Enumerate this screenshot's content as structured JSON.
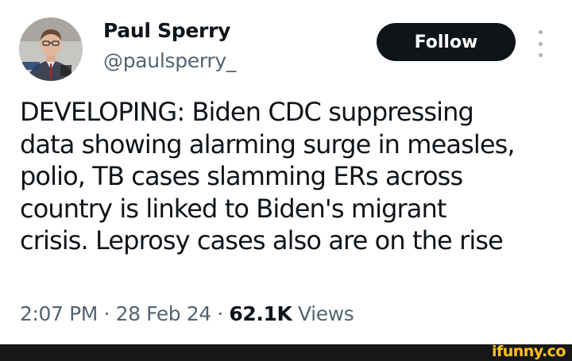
{
  "header": {
    "display_name": "Paul Sperry",
    "handle": "@paulsperry_",
    "follow_label": "Follow",
    "more_icon": "more-vertical-icon"
  },
  "tweet": {
    "text": "DEVELOPING: Biden CDC suppressing\ndata showing alarming surge in measles,\npolio, TB cases slamming ERs across\ncountry is linked to Biden's migrant\ncrisis. Leprosy cases also are on the rise"
  },
  "meta": {
    "time": "2:07 PM",
    "separator": "·",
    "date": "28 Feb 24",
    "views_count": "62.1K",
    "views_label": "Views"
  },
  "footer": {
    "watermark": "ifunny.co"
  },
  "colors": {
    "text_primary": "#0f1419",
    "text_secondary": "#536471",
    "follow_bg": "#0f1419",
    "watermark": "#ffc21d",
    "footer_bg": "#171717"
  }
}
